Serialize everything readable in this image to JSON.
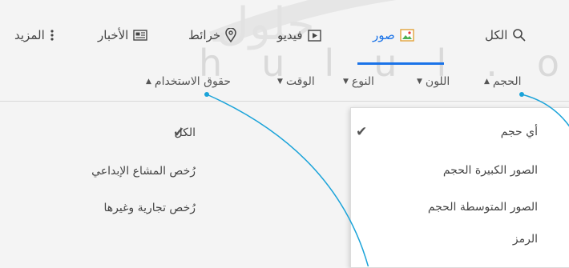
{
  "watermark": {
    "text": "حلول",
    "latin": [
      "h",
      "u",
      "l",
      "u",
      "l",
      ".",
      "o"
    ]
  },
  "nav": {
    "all_label": "الكل",
    "images_label": "صور",
    "videos_label": "فيديو",
    "maps_label": "خرائط",
    "news_label": "الأخبار",
    "more_label": "المزيد",
    "icons": {
      "all": "search-icon",
      "images": "image-icon",
      "videos": "play-icon",
      "maps": "location-pin-icon",
      "news": "newspaper-icon",
      "more": "vertical-dots-icon"
    }
  },
  "filters": {
    "size_label": "الحجم",
    "color_label": "اللون",
    "type_label": "النوع",
    "time_label": "الوقت",
    "rights_label": "حقوق الاستخدام"
  },
  "size_menu": {
    "items": [
      "أي حجم",
      "الصور الكبيرة الحجم",
      "الصور المتوسطة الحجم",
      "الرمز"
    ],
    "selected_index": 0
  },
  "rights_menu": {
    "items": [
      "الكل",
      "رُخص المشاع الإبداعي",
      "رُخص تجارية وغيرها"
    ],
    "selected_index": 0
  },
  "colors": {
    "accent": "#1a73e8",
    "pointer_line": "#1aa3d9",
    "background": "#f4f4f4",
    "menu_bg": "#ffffff"
  }
}
